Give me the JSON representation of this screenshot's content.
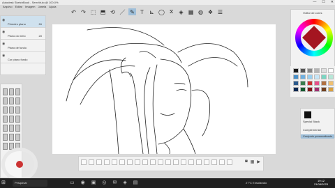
{
  "window": {
    "title": "Autodesk SketchBook - Sem título @ 100.0%",
    "minimize": "—",
    "maximize": "☐",
    "close": "✕"
  },
  "menu": [
    "Arquivo",
    "Editar",
    "Imagem",
    "Janela",
    "Ajuda"
  ],
  "toolbar": {
    "tools": [
      {
        "name": "undo-icon",
        "glyph": "↶"
      },
      {
        "name": "redo-icon",
        "glyph": "↷"
      },
      {
        "name": "select-icon",
        "glyph": "⬚"
      },
      {
        "name": "crop-icon",
        "glyph": "⬒"
      },
      {
        "name": "transform-icon",
        "glyph": "⟲"
      },
      {
        "name": "line-icon",
        "glyph": "／"
      },
      {
        "name": "pen-icon",
        "glyph": "✎"
      },
      {
        "name": "text-icon",
        "glyph": "T"
      },
      {
        "name": "ruler-icon",
        "glyph": "⊾"
      },
      {
        "name": "ellipse-icon",
        "glyph": "◯"
      },
      {
        "name": "symmetry-icon",
        "glyph": "⧖"
      },
      {
        "name": "fill-icon",
        "glyph": "◈"
      },
      {
        "name": "brush-library-icon",
        "glyph": "▦"
      },
      {
        "name": "color-wheel-icon",
        "glyph": "◍"
      },
      {
        "name": "copic-icon",
        "glyph": "❖"
      },
      {
        "name": "layers-icon",
        "glyph": "☰"
      }
    ],
    "active_index": 6
  },
  "layers": [
    {
      "name": "Primeiro plano",
      "mode": "2#"
    },
    {
      "name": "Plano do meio",
      "mode": "2#"
    },
    {
      "name": "Plano de fundo",
      "mode": ""
    },
    {
      "name": "Cor plano fundo",
      "mode": ""
    }
  ],
  "color_editor": {
    "header": "Editor de cores",
    "current_color": "#a41520"
  },
  "swatches": [
    "#1a1a1a",
    "#555555",
    "#888888",
    "#b5b5b5",
    "#dedede",
    "#ffffff",
    "#4a90c8",
    "#6fb0e0",
    "#9ad0f0",
    "#c6e6f8",
    "#7bd5c2",
    "#b8e8d8",
    "#2c5a8c",
    "#3a7d4e",
    "#c83030",
    "#e8508a",
    "#b07040",
    "#f0c070",
    "#0a2850",
    "#155a30",
    "#801818",
    "#a03070",
    "#704020",
    "#d8a040"
  ],
  "custom_brush": {
    "name": "Special Black",
    "complementar": "Complementar",
    "personalizado": "Conjunto personalizado"
  },
  "taskbar": {
    "start": "⊞",
    "search": "Pesquisar",
    "apps": [
      "▭",
      "◉",
      "▣",
      "◎",
      "✉",
      "◈",
      "▤"
    ],
    "weather": "27°C Ensolarado",
    "time": "19:12",
    "date": "21/08/2023"
  }
}
